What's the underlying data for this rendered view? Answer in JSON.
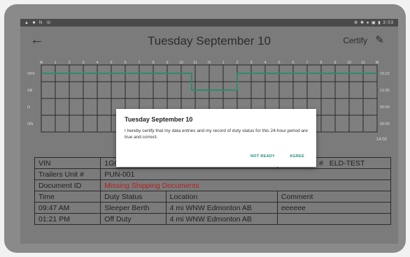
{
  "status_bar": {
    "left_icons": "▲ ■ N ☏",
    "right_text": "⚙ ✱ ● ▣ ▮ 3:03"
  },
  "app_bar": {
    "back_icon": "←",
    "title": "Tuesday September 10",
    "certify_label": "Certify",
    "edit_icon": "✎"
  },
  "log_grid": {
    "hour_labels": [
      "M",
      "1",
      "2",
      "3",
      "4",
      "5",
      "6",
      "7",
      "8",
      "9",
      "10",
      "11",
      "N",
      "1",
      "2",
      "3",
      "4",
      "5",
      "6",
      "7",
      "8",
      "9",
      "10",
      "11",
      "M"
    ],
    "row_labels": [
      "OFF",
      "SB",
      "D",
      "ON"
    ],
    "row_totals": [
      "10:22",
      "13:35",
      "00:00",
      "00:00"
    ],
    "total": "14:02"
  },
  "info_table": {
    "vin_label": "VIN",
    "vin_value": "1GCEK19…",
    "power_unit_label": "Power Unit #",
    "power_unit_value": "ELD-TEST",
    "trailers_label": "Trailers Unit #",
    "trailers_value": "PUN-001",
    "document_label": "Document ID",
    "document_value": "Missing Shipping Documents",
    "headers": [
      "Time",
      "Duty Status",
      "Location",
      "Comment"
    ],
    "rows": [
      [
        "09:47 AM",
        "Sleeper Berth",
        "4 mi WNW Edmonton AB",
        "eeeeee"
      ],
      [
        "01:21 PM",
        "Off Duty",
        "4 mi WNW Edmonton AB",
        ""
      ]
    ]
  },
  "dialog": {
    "title": "Tuesday September 10",
    "body": "I hereby certify that my data entries and my record of duty status for this 24-hour period are true and correct.",
    "not_ready_label": "NOT READY",
    "agree_label": "AGREE"
  },
  "colors": {
    "screen_dim": "#7b7b7b",
    "status_line": "#2e8a6e",
    "accent": "#1f8a7a",
    "warning": "#b32020"
  }
}
